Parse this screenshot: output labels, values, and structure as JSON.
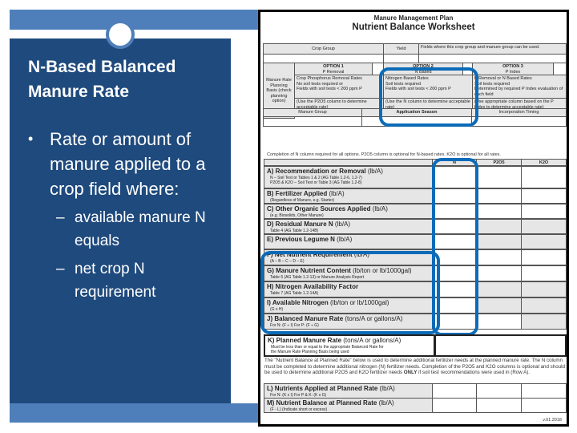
{
  "slide": {
    "title": "N-Based Balanced Manure Rate",
    "bullet_mark": "•",
    "sub_mark": "–",
    "bullet": "Rate or amount of manure applied to a crop field where:",
    "sub_bullets": [
      "available manure N equals",
      "net crop N requirement"
    ],
    "colors": {
      "panel": "#1f4a7d",
      "bars": "#4f7fbb",
      "highlight": "#0c6bb8"
    }
  },
  "worksheet": {
    "subtitle": "Manure Management Plan",
    "title": "Nutrient Balance Worksheet",
    "header": {
      "crop_group": "Crop Group",
      "yield": "Yield",
      "fields_note": "Fields where this crop group and manure group can be used."
    },
    "planning_basis_label": "Manure Rate Planning Basis (check planning option)",
    "options": [
      {
        "name": "OPTION 1",
        "sub": "P Removal",
        "bullets": [
          "Crop Phosphorus Removal Rates",
          "No soil tests required or",
          "Fields with soil tests < 200 ppm P"
        ],
        "note": "(Use the P2O5 column to determine acceptable rate)"
      },
      {
        "name": "OPTION 2",
        "sub": "N Based",
        "bullets": [
          "Nitrogen Based Rates",
          "Soil tests required",
          "Fields with soil tests < 200 ppm P"
        ],
        "note": "(Use the N column to determine acceptable rate)"
      },
      {
        "name": "OPTION 3",
        "sub": "P Index",
        "bullets": [
          "P Removal or N Based Rates",
          "Soil tests required",
          "Determined by required P Index evaluation of each field"
        ],
        "note": "(Use appropriate column based on the P Index to determine acceptable rate)"
      }
    ],
    "group_headers": [
      "Manure Group",
      "Application Season",
      "Incorporation Timing"
    ],
    "completion_note": "Completion of N column required for all options. P2O5 column is optional for N-based rates. K2O is optional for all rates.",
    "columns": [
      "N",
      "P2O5",
      "K2O"
    ],
    "rows": [
      {
        "label": "A) Recommendation or Removal",
        "unit": "(lb/A)",
        "subs": [
          "N – Soil Test or Tables 1 & 2 (AG Table 1.2-6, 1.2-7)",
          "P2O5 & K2O – Soil Test or Table 3 (AG Table 1.2-8)"
        ]
      },
      {
        "label": "B) Fertilizer Applied",
        "unit": "(lb/A)",
        "subs": [
          "(Regardless of Manure, e.g. Starter)"
        ]
      },
      {
        "label": "C) Other Organic Sources Applied",
        "unit": "(lb/A)",
        "subs": [
          "(e.g. Biosolids, Other Manure)"
        ]
      },
      {
        "label": "D) Residual Manure N",
        "unit": "(lb/A)",
        "subs": [
          "Table 4 (AG Table 1.2-14B)"
        ]
      },
      {
        "label": "E) Previous Legume N",
        "unit": "(lb/A)",
        "subs": [
          ""
        ]
      },
      {
        "label": "F) Net Nutrient Requirement",
        "unit": "(lb/A)",
        "subs": [
          "(A – B – C – D – E)"
        ]
      },
      {
        "label": "G) Manure Nutrient Content",
        "unit": "(lb/ton or lb/1000gal)",
        "subs": [
          "Table 6 (AG Table 1.2-13) or Manure Analysis Report"
        ]
      },
      {
        "label": "H) Nitrogen Availability Factor",
        "unit": "",
        "subs": [
          "Table 7 (AG Table 1.2-14A)"
        ]
      },
      {
        "label": "I) Available Nitrogen",
        "unit": "(lb/ton or lb/1000gal)",
        "subs": [
          "(G x H)"
        ]
      },
      {
        "label": "J) Balanced Manure Rate",
        "unit": "(tons/A or gallons/A)",
        "subs": [
          "For N: (F ÷ I)   For P: (F ÷ G)"
        ]
      }
    ],
    "row_k": {
      "label": "K) Planned Manure Rate",
      "unit": "(tons/A or gallons/A)",
      "subs": [
        "Must be less than or equal to the appropriate Balanced Rate for",
        "the Manure Rate Planning Basis being used"
      ]
    },
    "paragraph_pre": "The \"Nutrient Balance at Planned Rate\" below is used to determine additional fertilizer needs at the planned manure rate. The N column must be completed to determine additional nitrogen (N) fertilizer needs. Completion of the P2O5 and K2O columns is optional and should be used to determine additional P2O5 and K2O fertilizer needs",
    "paragraph_bold": "ONLY",
    "paragraph_post": " if soil test recommendations were used in (Row A).",
    "rows_lm": [
      {
        "label": "L) Nutrients Applied at Planned Rate",
        "unit": "(lb/A)",
        "subs": [
          "For N: (K x I)  For P & K: (K x G)"
        ]
      },
      {
        "label": "M) Nutrient Balance at Planned Rate",
        "unit": "(lb/A)",
        "subs": [
          "(F - L)   (Indicate short or excess)"
        ]
      }
    ],
    "version": "v.01.2018"
  }
}
